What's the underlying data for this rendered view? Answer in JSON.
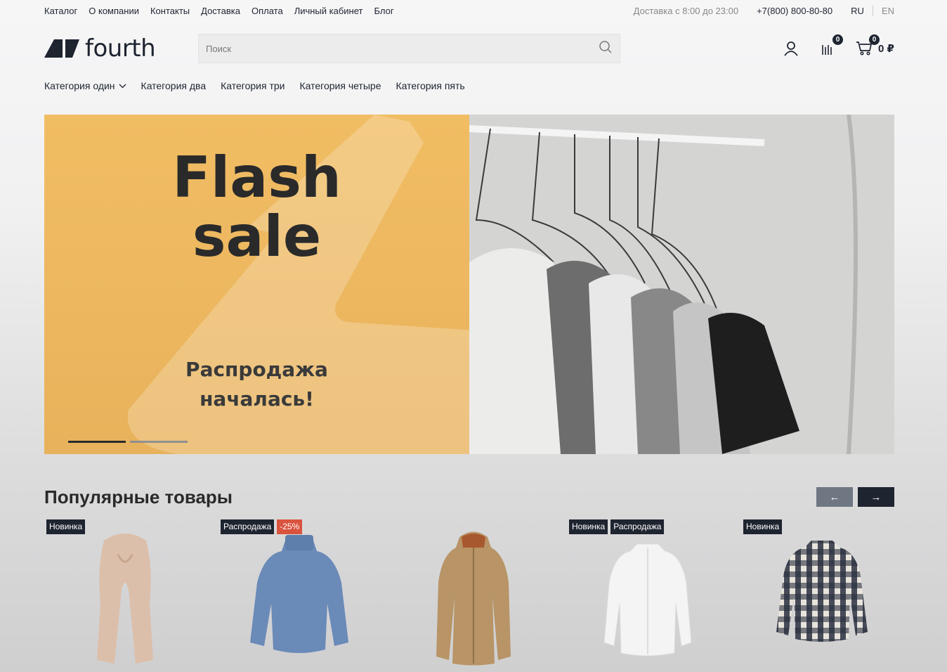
{
  "topbar": {
    "nav": [
      "Каталог",
      "О компании",
      "Контакты",
      "Доставка",
      "Оплата",
      "Личный кабинет",
      "Блог"
    ],
    "delivery": "Доставка с 8:00 до 23:00",
    "phone": "+7(800) 800-80-80",
    "lang_ru": "RU",
    "lang_en": "EN"
  },
  "header": {
    "logo_text": "fourth",
    "search_placeholder": "Поиск",
    "compare_count": "0",
    "cart_count": "0",
    "cart_total": "0 ₽"
  },
  "categories": [
    "Категория один",
    "Категория два",
    "Категория три",
    "Категория четыре",
    "Категория пять"
  ],
  "hero": {
    "title_line1": "Flash",
    "title_line2": "sale",
    "subtitle_line1": "Распродажа",
    "subtitle_line2": "началась!",
    "slide_count": 2,
    "active_slide": 1
  },
  "popular": {
    "title": "Популярные товары",
    "prev_label": "←",
    "next_label": "→",
    "products": [
      {
        "tags": [
          "Новинка"
        ],
        "image": "scarf"
      },
      {
        "tags": [
          "Распродажа",
          "-25%"
        ],
        "image": "sweater"
      },
      {
        "tags": [],
        "image": "raincoat"
      },
      {
        "tags": [
          "Новинка",
          "Распродажа"
        ],
        "image": "white-shirt"
      },
      {
        "tags": [
          "Новинка"
        ],
        "image": "plaid-shirt"
      }
    ]
  },
  "colors": {
    "brand_dark": "#1e2430",
    "sale_red": "#d9533e",
    "hero_yellow": "#f1bd63"
  }
}
